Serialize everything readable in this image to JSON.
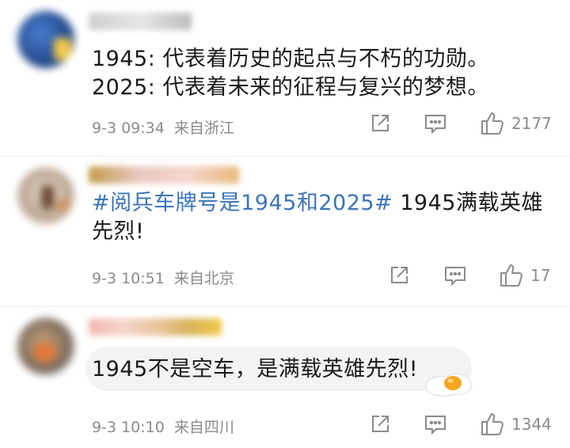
{
  "comments": [
    {
      "text_lines": [
        "1945:  代表着历史的起点与不朽的功勋。",
        "2025:  代表着未来的征程与复兴的梦想。"
      ],
      "time": "9-3 09:34",
      "location": "来自浙江",
      "likes": "2177",
      "actions": [
        "share-icon",
        "comment-icon",
        "like-icon"
      ]
    },
    {
      "hashtag": "#阅兵车牌号是1945和2025#",
      "text": " 1945满载英雄先烈!",
      "time": "9-3 10:51",
      "location": "来自北京",
      "likes": "17",
      "actions": [
        "share-icon",
        "comment-icon",
        "like-icon"
      ]
    },
    {
      "text": "1945不是空车，是满载英雄先烈!",
      "time": "9-3 10:10",
      "location": "来自四川",
      "likes": "1344",
      "emoji": "egg-icon",
      "actions": [
        "share-icon",
        "comment-icon",
        "like-icon"
      ]
    }
  ],
  "colors": {
    "hashtag": "#3b74b7",
    "meta": "#8b8b8b",
    "text": "#1a1a1a"
  }
}
